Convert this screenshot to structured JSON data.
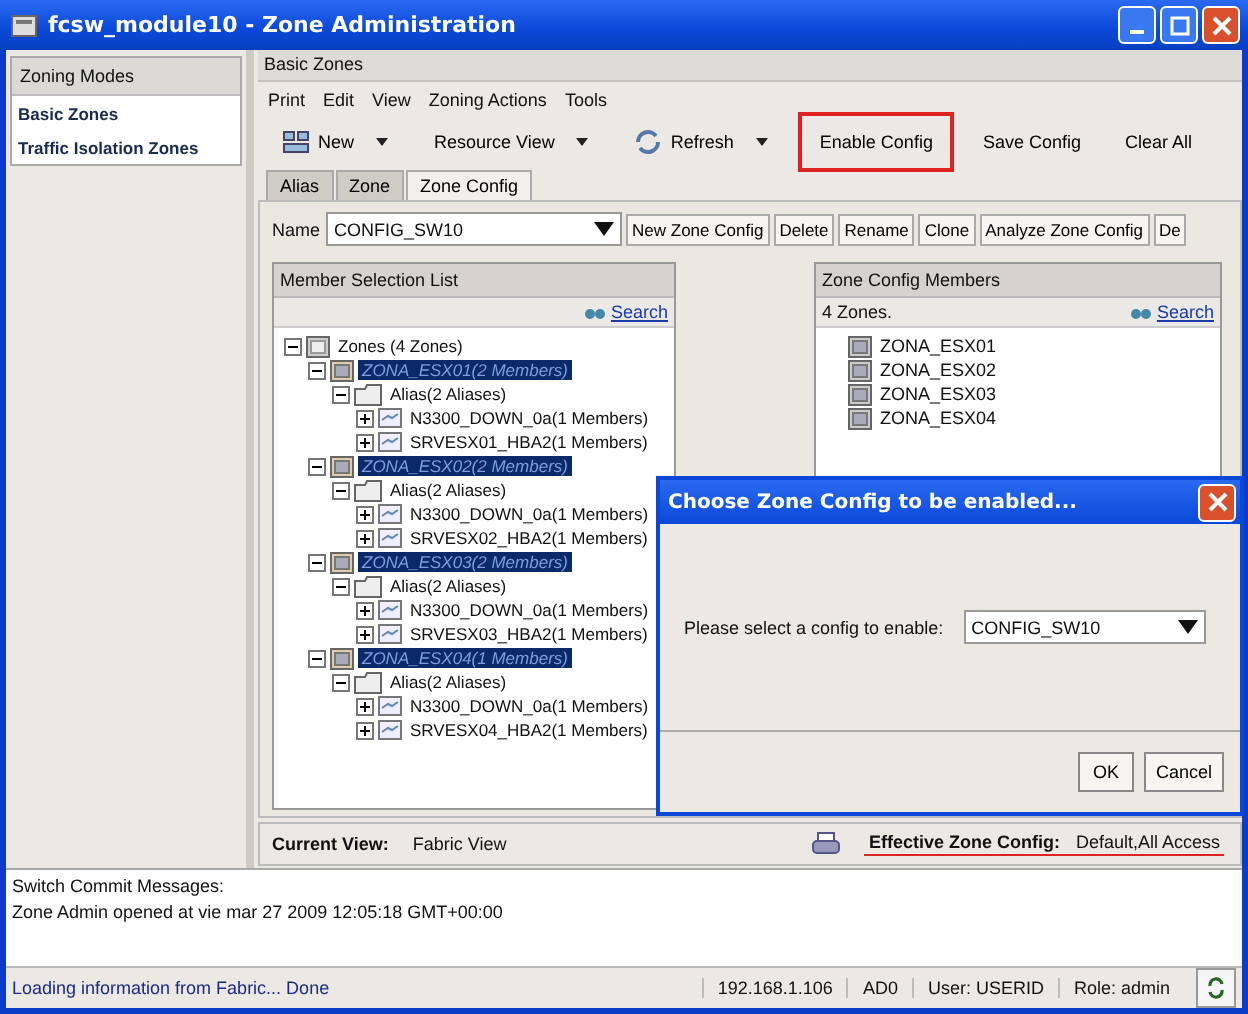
{
  "window": {
    "title": "fcsw_module10 - Zone Administration"
  },
  "sidebar": {
    "title": "Zoning Modes",
    "items": [
      {
        "label": "Basic Zones"
      },
      {
        "label": "Traffic Isolation Zones"
      }
    ]
  },
  "panel_title": "Basic Zones",
  "menu": [
    "Print",
    "Edit",
    "View",
    "Zoning Actions",
    "Tools"
  ],
  "toolbar": [
    {
      "label": "New",
      "kind": "dropdown",
      "highlighted": false
    },
    {
      "label": "Resource View",
      "kind": "dropdown",
      "highlighted": false
    },
    {
      "label": "Refresh",
      "kind": "dropdown",
      "highlighted": false
    },
    {
      "label": "Enable Config",
      "kind": "plain",
      "highlighted": true
    },
    {
      "label": "Save Config",
      "kind": "plain",
      "highlighted": false
    },
    {
      "label": "Clear All",
      "kind": "plain",
      "highlighted": false
    }
  ],
  "tabs": [
    {
      "label": "Alias",
      "selected": false
    },
    {
      "label": "Zone",
      "selected": false
    },
    {
      "label": "Zone Config",
      "selected": true
    }
  ],
  "name_label": "Name",
  "name_value": "CONFIG_SW10",
  "actions": [
    "New Zone Config",
    "Delete",
    "Rename",
    "Clone",
    "Analyze Zone Config",
    "De"
  ],
  "member_list": {
    "title": "Member Selection List",
    "search": "Search",
    "tree": [
      {
        "label": "Zones (4 Zones)",
        "kind": "group",
        "expanded": true,
        "selected": false,
        "children": [
          {
            "label": "ZONA_ESX01(2 Members)",
            "kind": "zone",
            "expanded": true,
            "selected": true,
            "children": [
              {
                "label": "Alias(2 Aliases)",
                "kind": "alias",
                "expanded": true,
                "selected": false,
                "children": [
                  {
                    "label": "N3300_DOWN_0a(1 Members)",
                    "kind": "member",
                    "expanded": false,
                    "selected": false
                  },
                  {
                    "label": "SRVESX01_HBA2(1 Members)",
                    "kind": "member",
                    "expanded": false,
                    "selected": false
                  }
                ]
              }
            ]
          },
          {
            "label": "ZONA_ESX02(2 Members)",
            "kind": "zone",
            "expanded": true,
            "selected": true,
            "children": [
              {
                "label": "Alias(2 Aliases)",
                "kind": "alias",
                "expanded": true,
                "selected": false,
                "children": [
                  {
                    "label": "N3300_DOWN_0a(1 Members)",
                    "kind": "member",
                    "expanded": false,
                    "selected": false
                  },
                  {
                    "label": "SRVESX02_HBA2(1 Members)",
                    "kind": "member",
                    "expanded": false,
                    "selected": false
                  }
                ]
              }
            ]
          },
          {
            "label": "ZONA_ESX03(2 Members)",
            "kind": "zone",
            "expanded": true,
            "selected": true,
            "children": [
              {
                "label": "Alias(2 Aliases)",
                "kind": "alias",
                "expanded": true,
                "selected": false,
                "children": [
                  {
                    "label": "N3300_DOWN_0a(1 Members)",
                    "kind": "member",
                    "expanded": false,
                    "selected": false
                  },
                  {
                    "label": "SRVESX03_HBA2(1 Members)",
                    "kind": "member",
                    "expanded": false,
                    "selected": false
                  }
                ]
              }
            ]
          },
          {
            "label": "ZONA_ESX04(1 Members)",
            "kind": "zone",
            "expanded": true,
            "selected": true,
            "children": [
              {
                "label": "Alias(2 Aliases)",
                "kind": "alias",
                "expanded": true,
                "selected": false,
                "children": [
                  {
                    "label": "N3300_DOWN_0a(1 Members)",
                    "kind": "member",
                    "expanded": false,
                    "selected": false
                  },
                  {
                    "label": "SRVESX04_HBA2(1 Members)",
                    "kind": "member",
                    "expanded": false,
                    "selected": false
                  }
                ]
              }
            ]
          }
        ]
      }
    ]
  },
  "config_members": {
    "title": "Zone Config Members",
    "count": "4 Zones.",
    "search": "Search",
    "items": [
      "ZONA_ESX01",
      "ZONA_ESX02",
      "ZONA_ESX03",
      "ZONA_ESX04"
    ]
  },
  "footer": {
    "current_view_label": "Current View:",
    "current_view": "Fabric View",
    "effective_label": "Effective Zone Config:",
    "effective_value": "Default,All Access"
  },
  "messages": {
    "title": "Switch Commit Messages:",
    "lines": [
      "Zone Admin opened at vie mar 27 2009 12:05:18 GMT+00:00"
    ]
  },
  "status_bar": {
    "message": "Loading information from Fabric... Done",
    "fields": [
      "192.168.1.106",
      "AD0",
      "User: USERID",
      "Role: admin"
    ]
  },
  "dialog": {
    "title": "Choose Zone Config to be enabled...",
    "prompt": "Please select a config to enable:",
    "value": "CONFIG_SW10",
    "buttons": [
      "OK",
      "Cancel"
    ]
  }
}
